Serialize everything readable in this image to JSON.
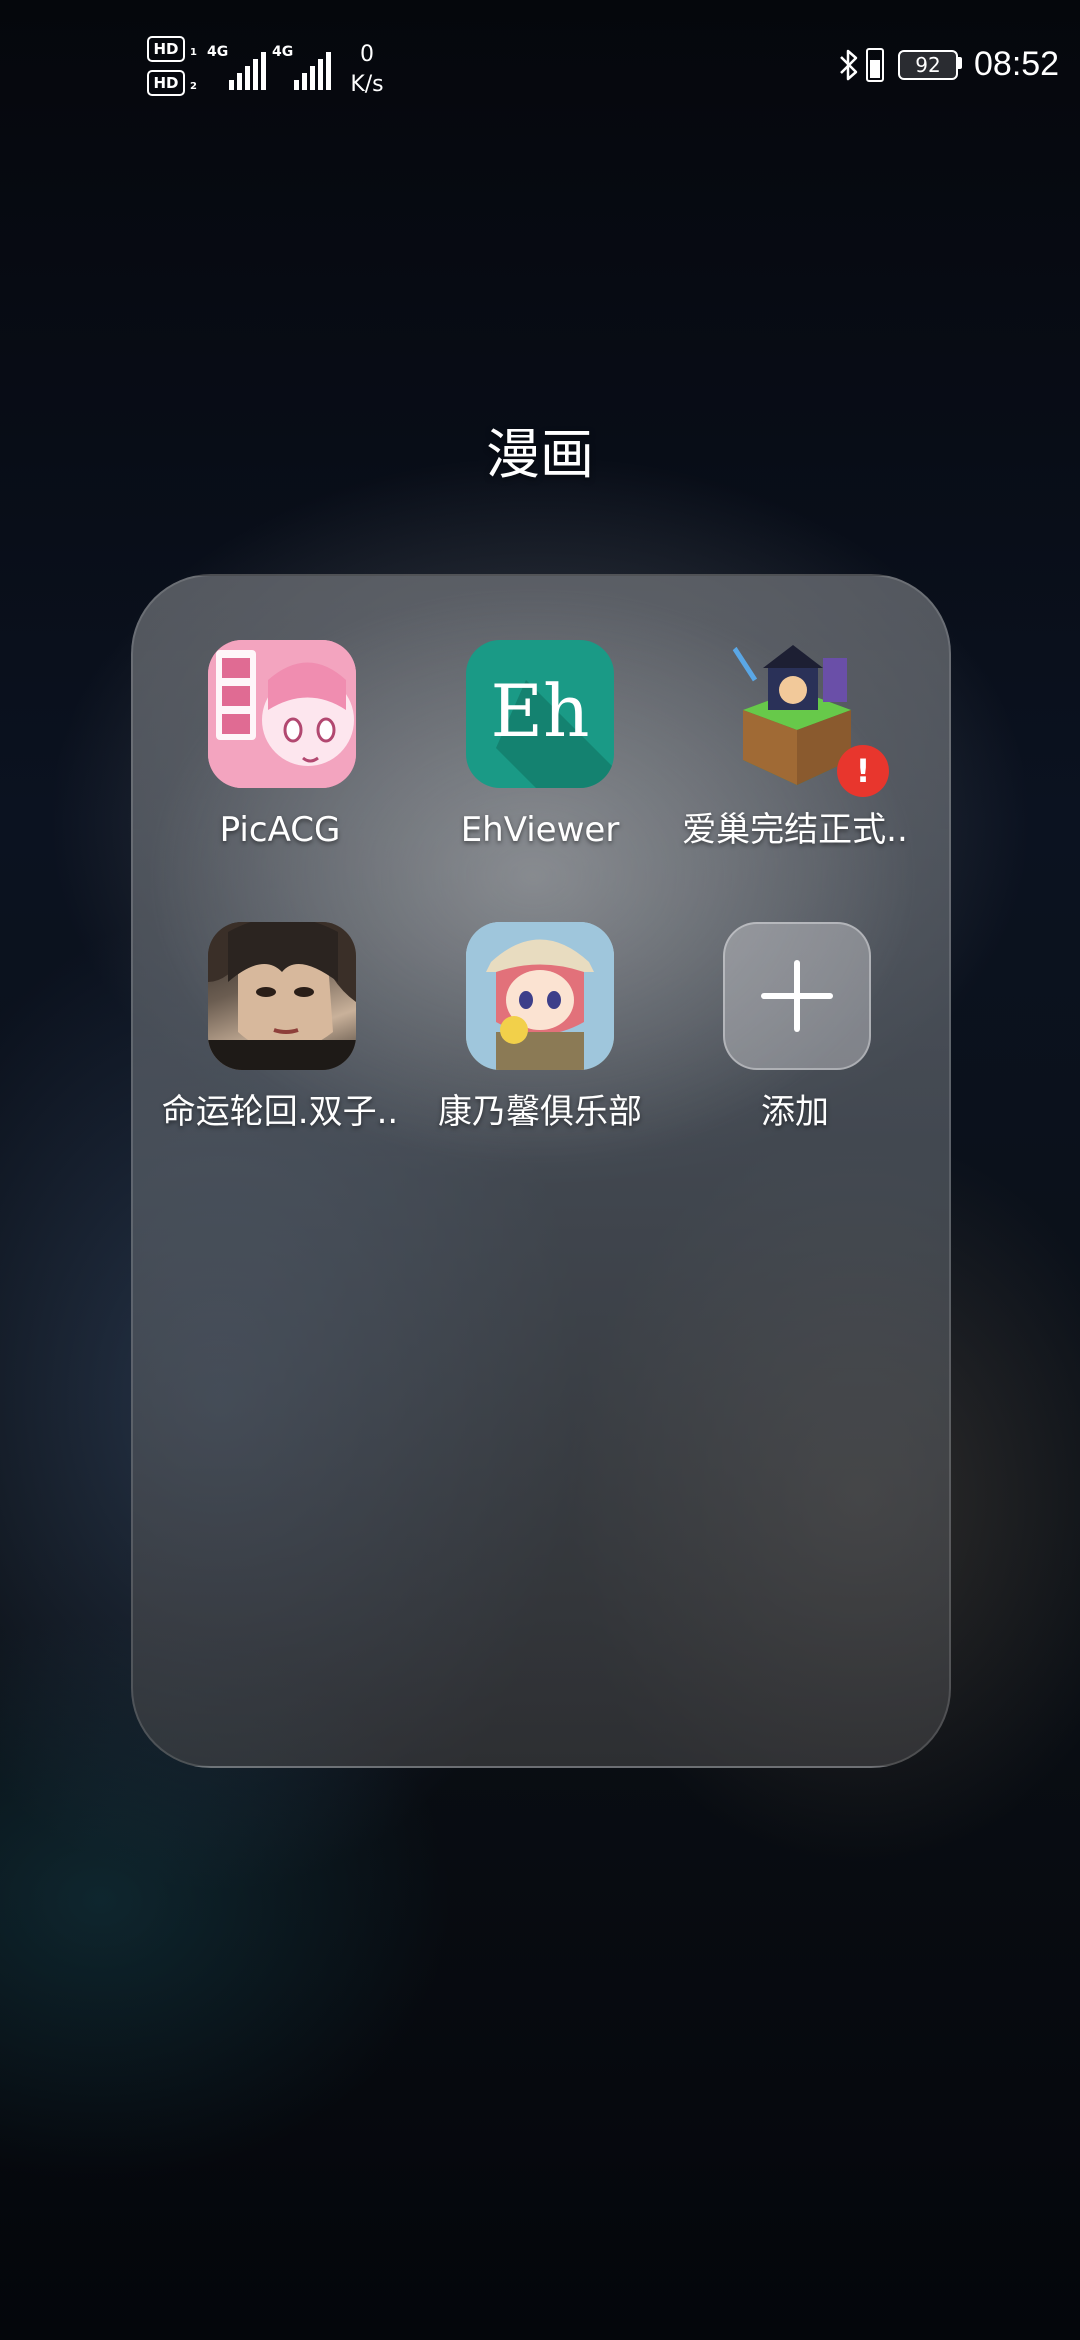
{
  "status_bar": {
    "sim1_label": "HD",
    "sim1_index": "1",
    "sim2_label": "HD",
    "sim2_index": "2",
    "signal1_type": "4G",
    "signal2_type": "4G",
    "net_speed_value": "0",
    "net_speed_unit": "K/s",
    "battery_level": "92",
    "time": "08:52",
    "icons": [
      "bluetooth-icon",
      "battery-saver-icon",
      "battery-icon"
    ]
  },
  "folder": {
    "title": "漫画",
    "apps": [
      {
        "name": "PicACG",
        "icon": "picacg-icon"
      },
      {
        "name": "EhViewer",
        "icon": "ehviewer-icon",
        "icon_text": "Eh"
      },
      {
        "name": "爱巢完结正式..",
        "icon": "aichao-icon",
        "badge": "!"
      },
      {
        "name": "命运轮回.双子..",
        "icon": "mingyun-icon"
      },
      {
        "name": "康乃馨俱乐部",
        "icon": "kangnaixin-icon"
      },
      {
        "name": "添加",
        "icon": "plus-icon"
      }
    ]
  },
  "colors": {
    "eh_icon_bg": "#1a9a86",
    "badge_red": "#e8362d",
    "picacg_pink": "#ec7fa6"
  }
}
